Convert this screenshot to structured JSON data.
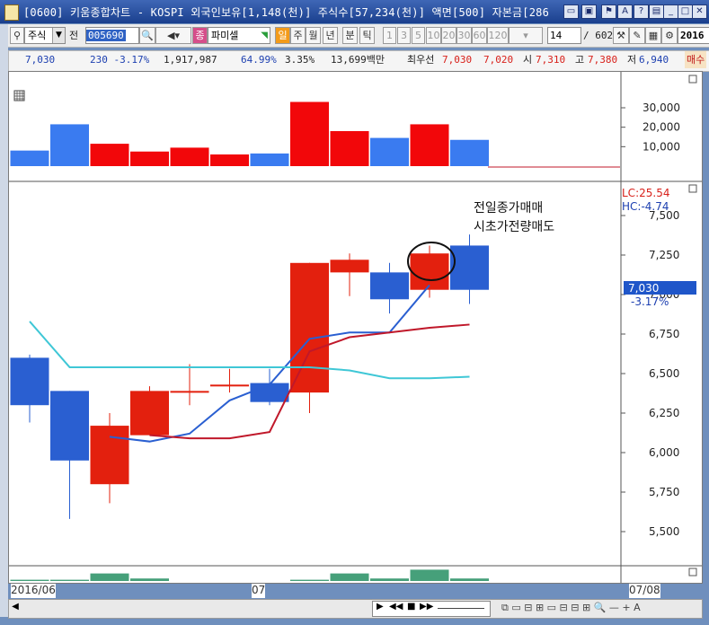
{
  "window": {
    "title": "[0600] 키움종합차트 - KOSPI 외국인보유[1,148(천)] 주식수[57,234(천)] 액면[500] 자본금[286"
  },
  "toolbar": {
    "market_type": "주식",
    "prev_label": "전",
    "stock_code": "005690",
    "stock_name": "파미셀",
    "period_tabs": [
      "일",
      "주",
      "월",
      "년",
      "분",
      "틱"
    ],
    "tick_buttons": [
      "1",
      "3",
      "5",
      "10",
      "20",
      "30",
      "60",
      "120"
    ],
    "count_value": "14",
    "count_total": "/ 602",
    "date_field": "2016"
  },
  "quote": {
    "price": "7,030",
    "change": "230 -3.17%",
    "volume": "1,917,987",
    "ratio": "64.99%",
    "turnover": "3.35%",
    "amount": "13,699백만",
    "best_label": "최우선",
    "best_ask": "7,030",
    "best_bid": "7,020",
    "open_label": "시",
    "open": "7,310",
    "high_label": "고",
    "high": "7,380",
    "low_label": "저",
    "low": "6,940",
    "more_label": "매수"
  },
  "annotation": {
    "line1": "전일종가매매",
    "line2": "시초가전량매도"
  },
  "price_axis": {
    "lc_label": "LC:25.54",
    "hc_label": "HC:-4.74",
    "current_price": "7,030",
    "current_change": "-3.17%",
    "ticks": [
      "7,500",
      "7,250",
      "7,000",
      "6,750",
      "6,500",
      "6,250",
      "6,000",
      "5,750",
      "5,500"
    ]
  },
  "volume_axis": {
    "ticks": [
      "30,000",
      "20,000",
      "10,000"
    ]
  },
  "date_axis": {
    "left": "2016/06",
    "mid": "07",
    "right": "07/08"
  },
  "colors": {
    "up": "#e3200e",
    "down": "#2a5fd1",
    "ma_short": "#2a5fd1",
    "ma_mid": "#c0182a",
    "ma_long": "#3fc7d6",
    "sub_volume": "#46a07a",
    "accent": "#1a3f8d"
  },
  "chart_data": [
    {
      "type": "candlestick",
      "title": "",
      "ylim": [
        5300,
        7700
      ],
      "candles": [
        {
          "open": 6600,
          "close": 6300,
          "high": 6620,
          "low": 6190,
          "dir": "down"
        },
        {
          "open": 6390,
          "close": 5950,
          "high": 6390,
          "low": 5580,
          "dir": "down"
        },
        {
          "open": 5800,
          "close": 6170,
          "high": 6250,
          "low": 5680,
          "dir": "up"
        },
        {
          "open": 6110,
          "close": 6390,
          "high": 6420,
          "low": 6110,
          "dir": "up"
        },
        {
          "open": 6380,
          "close": 6390,
          "high": 6560,
          "low": 6300,
          "dir": "up"
        },
        {
          "open": 6420,
          "close": 6430,
          "high": 6530,
          "low": 6380,
          "dir": "up"
        },
        {
          "open": 6440,
          "close": 6320,
          "high": 6530,
          "low": 6300,
          "dir": "down"
        },
        {
          "open": 6380,
          "close": 7200,
          "high": 7200,
          "low": 6250,
          "dir": "up"
        },
        {
          "open": 7140,
          "close": 7220,
          "high": 7260,
          "low": 6990,
          "dir": "up"
        },
        {
          "open": 7140,
          "close": 6970,
          "high": 7200,
          "low": 6880,
          "dir": "down"
        },
        {
          "open": 7030,
          "close": 7260,
          "high": 7310,
          "low": 6980,
          "dir": "up"
        },
        {
          "open": 7310,
          "close": 7030,
          "high": 7380,
          "low": 6940,
          "dir": "down"
        }
      ],
      "moving_averages": [
        {
          "name": "ma_short",
          "color_key": "ma_short",
          "values": [
            null,
            null,
            6100,
            6070,
            6120,
            6330,
            6430,
            6720,
            6760,
            6760,
            7060,
            null
          ]
        },
        {
          "name": "ma_mid",
          "color_key": "ma_mid",
          "values": [
            null,
            null,
            null,
            6110,
            6090,
            6090,
            6130,
            6640,
            6730,
            6760,
            6790,
            6810
          ]
        },
        {
          "name": "ma_long",
          "color_key": "ma_long",
          "values": [
            6830,
            6540,
            6540,
            6540,
            6540,
            6540,
            6540,
            6540,
            6520,
            6470,
            6470,
            6480
          ]
        }
      ]
    },
    {
      "type": "bar",
      "title": "",
      "ylim": [
        0,
        34000
      ],
      "values": [
        8000,
        21500,
        11500,
        7500,
        9500,
        6000,
        6500,
        33000,
        18000,
        14500,
        21500,
        13500
      ],
      "directions": [
        "down",
        "down",
        "up",
        "up",
        "up",
        "up",
        "down",
        "up",
        "up",
        "down",
        "up",
        "down"
      ]
    },
    {
      "type": "bar",
      "title": "",
      "values": [
        1,
        1,
        6,
        2,
        0,
        0,
        0,
        1,
        6,
        2,
        9,
        2
      ]
    }
  ]
}
